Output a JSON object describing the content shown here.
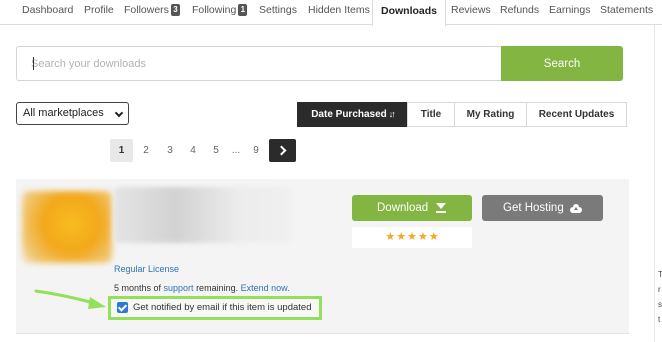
{
  "tabs": [
    {
      "label": "Dashboard",
      "count": null
    },
    {
      "label": "Profile",
      "count": null
    },
    {
      "label": "Followers",
      "count": "3"
    },
    {
      "label": "Following",
      "count": "1"
    },
    {
      "label": "Settings",
      "count": null
    },
    {
      "label": "Hidden Items",
      "count": null
    },
    {
      "label": "Downloads",
      "count": null,
      "active": true
    },
    {
      "label": "Reviews",
      "count": null
    },
    {
      "label": "Refunds",
      "count": null
    },
    {
      "label": "Earnings",
      "count": null
    },
    {
      "label": "Statements",
      "count": null
    }
  ],
  "search": {
    "placeholder": "Search your downloads",
    "value": "",
    "button_label": "Search"
  },
  "filter": {
    "marketplace_selected": "All marketplaces"
  },
  "sort": {
    "buttons": [
      "Date Purchased",
      "Title",
      "My Rating",
      "Recent Updates"
    ],
    "active": "Date Purchased",
    "active_icon": "sort-descending-icon"
  },
  "pagination": {
    "current": "1",
    "pages": [
      "1",
      "2",
      "3",
      "4",
      "5",
      "...",
      "9"
    ],
    "next_icon": "chevron-right-icon"
  },
  "item": {
    "license": "Regular License",
    "support_prefix": "5 months of ",
    "support_link": "support",
    "support_middle": " remaining. ",
    "extend_link": "Extend now.",
    "notify_label": "Get notified by email if this item is updated",
    "notify_checked": true,
    "download_label": "Download",
    "hosting_label": "Get Hosting",
    "rating_stars": 5
  },
  "side_letters": [
    "T",
    "r",
    "s",
    "t"
  ],
  "colors": {
    "accent_green": "#82b541",
    "highlight_green": "#93e05b",
    "dark": "#2b2b2b",
    "link_blue": "#2e72b8",
    "star_orange": "#f5a623",
    "hosting_gray": "#7a7a7a"
  }
}
